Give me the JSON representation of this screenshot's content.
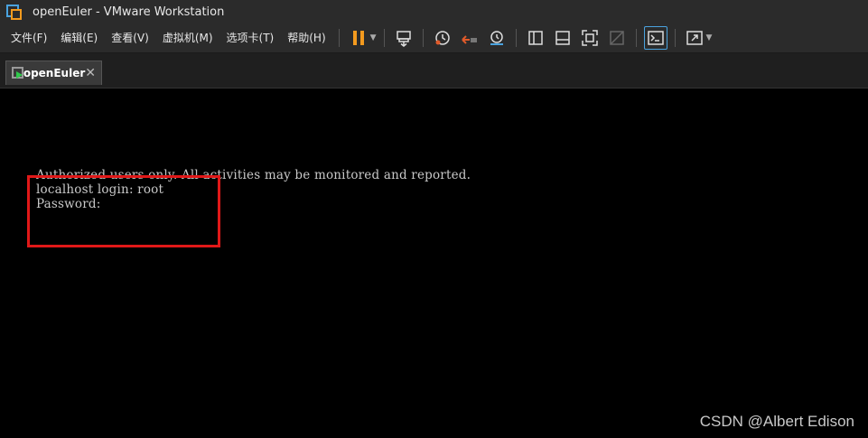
{
  "window": {
    "title": "openEuler - VMware Workstation"
  },
  "menu": [
    {
      "label": "文件(F)"
    },
    {
      "label": "编辑(E)"
    },
    {
      "label": "查看(V)"
    },
    {
      "label": "虚拟机(M)"
    },
    {
      "label": "选项卡(T)"
    },
    {
      "label": "帮助(H)"
    }
  ],
  "toolbar_icons": [
    "pause-icon",
    "send-ctrl-alt-del-icon",
    "snapshot-take-icon",
    "snapshot-revert-icon",
    "snapshot-manager-icon",
    "library-view-icon",
    "thumbnail-view-icon",
    "fullscreen-icon",
    "unity-icon",
    "console-view-icon",
    "stretch-guest-icon"
  ],
  "tab": {
    "label": "openEuler",
    "close_glyph": "✕"
  },
  "console": {
    "lines": [
      "Authorized users only. All activities may be monitored and reported.",
      "localhost login: root",
      "Password:"
    ]
  },
  "watermark": "CSDN @Albert Edison",
  "colors": {
    "accent_orange": "#f39a1e",
    "accent_blue": "#4aa3df",
    "highlight_red": "#e01818",
    "chrome_bg": "#2b2b2b",
    "console_bg": "#000000"
  }
}
